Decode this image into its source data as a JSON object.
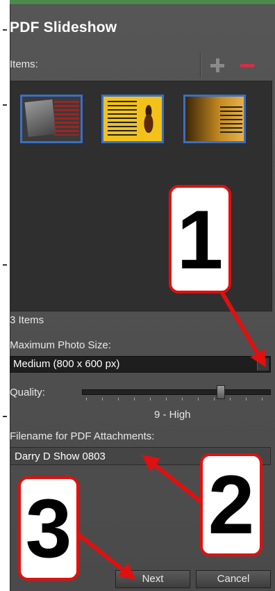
{
  "window": {
    "title": "PDF Slideshow"
  },
  "items": {
    "label": "Items:",
    "add_icon": "plus-icon",
    "remove_icon": "minus-icon",
    "count_label": "3 Items",
    "thumbnails": [
      {
        "name": "photo-thumbnail-1"
      },
      {
        "name": "photo-thumbnail-2"
      },
      {
        "name": "photo-thumbnail-3"
      }
    ]
  },
  "photo_size": {
    "label": "Maximum Photo Size:",
    "selected": "Medium (800 x 600 px)"
  },
  "quality": {
    "label": "Quality:",
    "value_label": "9 - High",
    "level": 9
  },
  "filename": {
    "label": "Filename for PDF Attachments:",
    "value": "Darry D Show 0803"
  },
  "buttons": {
    "next": "Next",
    "cancel": "Cancel"
  },
  "callouts": {
    "one": "1",
    "two": "2",
    "three": "3"
  },
  "colors": {
    "panel": "#4f4f4f",
    "thumbnail_border": "#3b6fc4",
    "remove_accent": "#d0304a",
    "callout_border": "#e01010"
  }
}
